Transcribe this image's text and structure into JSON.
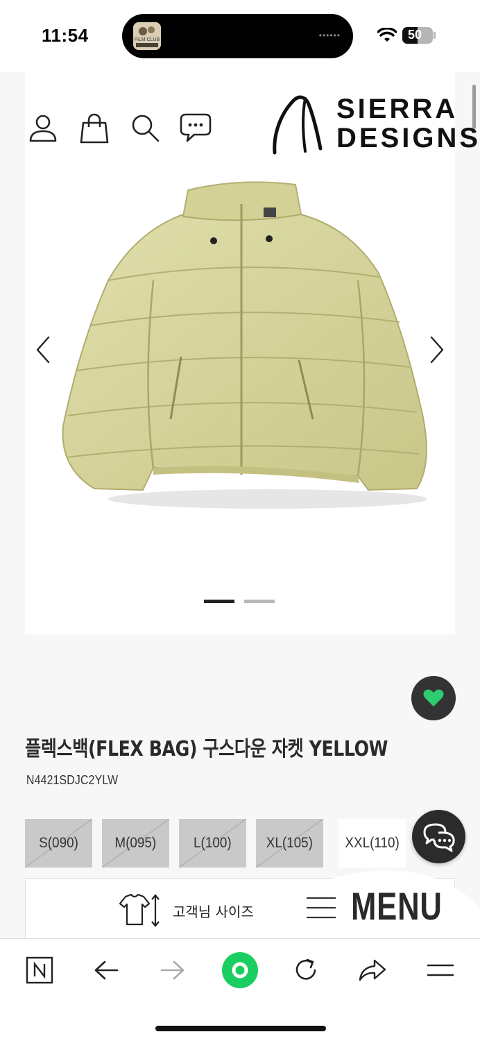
{
  "status_bar": {
    "time": "11:54",
    "island_app_label": "FILM CLUB",
    "island_dots": "••••••",
    "battery_level": 50,
    "battery_text": "50"
  },
  "header": {
    "icons": [
      "user-icon",
      "shopping-bag-icon",
      "search-icon",
      "chat-bubble-icon"
    ],
    "brand_line1": "SIERRA",
    "brand_line2": "DESIGNS"
  },
  "gallery": {
    "slide_count": 2,
    "active_index": 0,
    "jacket_color": "#d6d49c"
  },
  "product": {
    "title": "플렉스백(FLEX BAG) 구스다운 자켓 YELLOW",
    "code": "N4421SDJC2YLW",
    "wishlist_color": "#2ecc71"
  },
  "sizes": [
    {
      "label": "S(090)",
      "available": false
    },
    {
      "label": "M(095)",
      "available": false
    },
    {
      "label": "L(100)",
      "available": false
    },
    {
      "label": "XL(105)",
      "available": false
    },
    {
      "label": "XXL(110)",
      "available": true
    }
  ],
  "size_guide": {
    "label": "고객님 사이즈"
  },
  "menu": {
    "label": "MENU"
  },
  "toolbar": {
    "items": [
      "naver-home-icon",
      "back-arrow-icon",
      "forward-arrow-icon",
      "green-dot-icon",
      "reload-icon",
      "share-icon",
      "hamburger-icon"
    ],
    "accent": "#19ce60"
  }
}
